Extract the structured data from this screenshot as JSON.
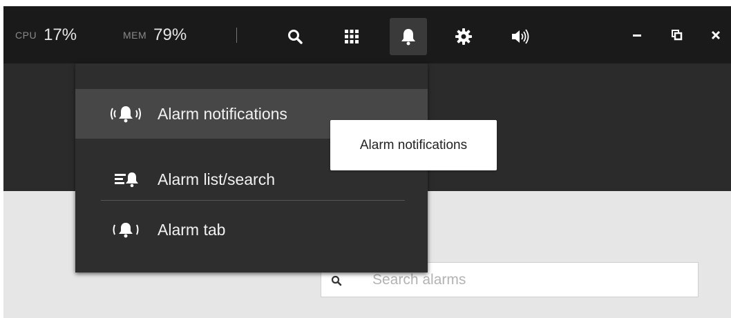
{
  "topbar": {
    "cpu_label": "CPU",
    "cpu_value": "17%",
    "mem_label": "MEM",
    "mem_value": "79%",
    "icons": [
      "search-icon",
      "grid-icon",
      "bell-icon",
      "gear-icon",
      "speaker-icon"
    ],
    "window_controls": [
      "minimize-icon",
      "restore-icon",
      "close-icon"
    ]
  },
  "alarm_menu": {
    "items": [
      {
        "label": "Alarm notifications",
        "icon": "alarm-ringing-icon",
        "hovered": true
      },
      {
        "label": "Alarm list/search",
        "icon": "alarm-list-icon",
        "hovered": false
      },
      {
        "label": "Alarm tab",
        "icon": "alarm-tab-icon",
        "hovered": false
      }
    ]
  },
  "tooltip": {
    "text": "Alarm notifications"
  },
  "search": {
    "placeholder": "Search alarms",
    "value": ""
  },
  "colors": {
    "topbar_bg": "#1a1a1a",
    "banner_bg": "#2b2b2b",
    "menu_bg": "#2e2e2e",
    "menu_hover_bg": "#474747",
    "page_bg": "#e6e6e6"
  }
}
